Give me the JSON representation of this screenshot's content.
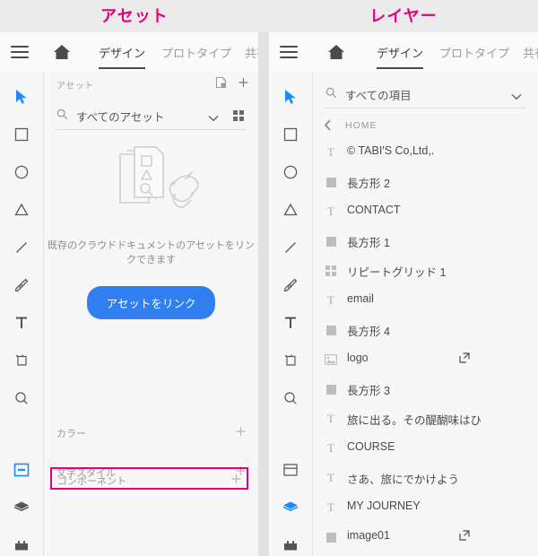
{
  "annotations": {
    "left": "アセット",
    "right": "レイヤー",
    "color": "#e6007e"
  },
  "accent": {
    "blue": "#2f7ff0",
    "active_tool": "#1a8cff"
  },
  "header": {
    "menu_icon": "hamburger-icon",
    "home_icon": "home-icon",
    "tabs": [
      {
        "label": "デザイン",
        "active": true
      },
      {
        "label": "プロトタイプ",
        "active": false
      },
      {
        "label": "共有",
        "active": false
      }
    ]
  },
  "toolbar": {
    "tools": [
      {
        "name": "select-tool",
        "icon": "cursor-arrow-icon",
        "active": true
      },
      {
        "name": "rectangle-tool",
        "icon": "rectangle-icon",
        "active": false
      },
      {
        "name": "ellipse-tool",
        "icon": "ellipse-icon",
        "active": false
      },
      {
        "name": "polygon-tool",
        "icon": "triangle-icon",
        "active": false
      },
      {
        "name": "line-tool",
        "icon": "line-icon",
        "active": false
      },
      {
        "name": "pen-tool",
        "icon": "pen-icon",
        "active": false
      },
      {
        "name": "text-tool",
        "icon": "text-t-icon",
        "active": false
      },
      {
        "name": "artboard-tool",
        "icon": "artboard-icon",
        "active": false
      },
      {
        "name": "zoom-tool",
        "icon": "magnifier-icon",
        "active": false
      }
    ],
    "panels": [
      {
        "name": "assets-panel-toggle",
        "icon": "component-panel-icon"
      },
      {
        "name": "layers-panel-toggle",
        "icon": "layers-stack-icon"
      },
      {
        "name": "plugins-panel-toggle",
        "icon": "plugin-puzzle-icon"
      }
    ]
  },
  "assets_panel": {
    "title": "アセット",
    "header_icons": [
      {
        "name": "new-document-icon"
      },
      {
        "name": "plus-icon"
      }
    ],
    "search": {
      "value": "すべてのアセット",
      "placeholder": "すべてのアセット",
      "search_icon": "search-icon",
      "dropdown_icon": "chevron-down-icon",
      "grid_view_icon": "grid-view-icon"
    },
    "empty_state": {
      "illustration": "linked-documents-icon",
      "message": "既存のクラウドドキュメントのアセットをリンクできます",
      "button_label": "アセットをリンク"
    },
    "sections": [
      {
        "label": "カラー",
        "add_icon": "plus-icon",
        "highlighted": false
      },
      {
        "label": "文字スタイル",
        "add_icon": "plus-icon",
        "highlighted": false
      },
      {
        "label": "コンポーネント",
        "add_icon": "plus-icon",
        "highlighted": true
      }
    ]
  },
  "layers_panel": {
    "search": {
      "value": "すべての項目",
      "placeholder": "すべての項目",
      "search_icon": "search-icon",
      "dropdown_icon": "chevron-down-icon"
    },
    "breadcrumb": {
      "back_icon": "chevron-left-icon",
      "label": "HOME"
    },
    "layers": [
      {
        "name": "© TABI'S Co,Ltd,.",
        "type": "text",
        "linked": false
      },
      {
        "name": "長方形 2",
        "type": "shape",
        "linked": false
      },
      {
        "name": "CONTACT",
        "type": "text",
        "linked": false
      },
      {
        "name": "長方形 1",
        "type": "shape",
        "linked": false
      },
      {
        "name": "リピートグリッド 1",
        "type": "repeatgrid",
        "linked": false
      },
      {
        "name": "email",
        "type": "text",
        "linked": false
      },
      {
        "name": "長方形 4",
        "type": "shape",
        "linked": false
      },
      {
        "name": "logo",
        "type": "image",
        "linked": true
      },
      {
        "name": "長方形 3",
        "type": "shape",
        "linked": false
      },
      {
        "name": "旅に出る。その醍醐味はひとそれぞれ…",
        "type": "text",
        "linked": false
      },
      {
        "name": "COURSE",
        "type": "text",
        "linked": false
      },
      {
        "name": "さあ、旅にでかけよう",
        "type": "text",
        "linked": false
      },
      {
        "name": "MY JOURNEY",
        "type": "text",
        "linked": false
      },
      {
        "name": "image01",
        "type": "shape",
        "linked": true
      }
    ]
  }
}
